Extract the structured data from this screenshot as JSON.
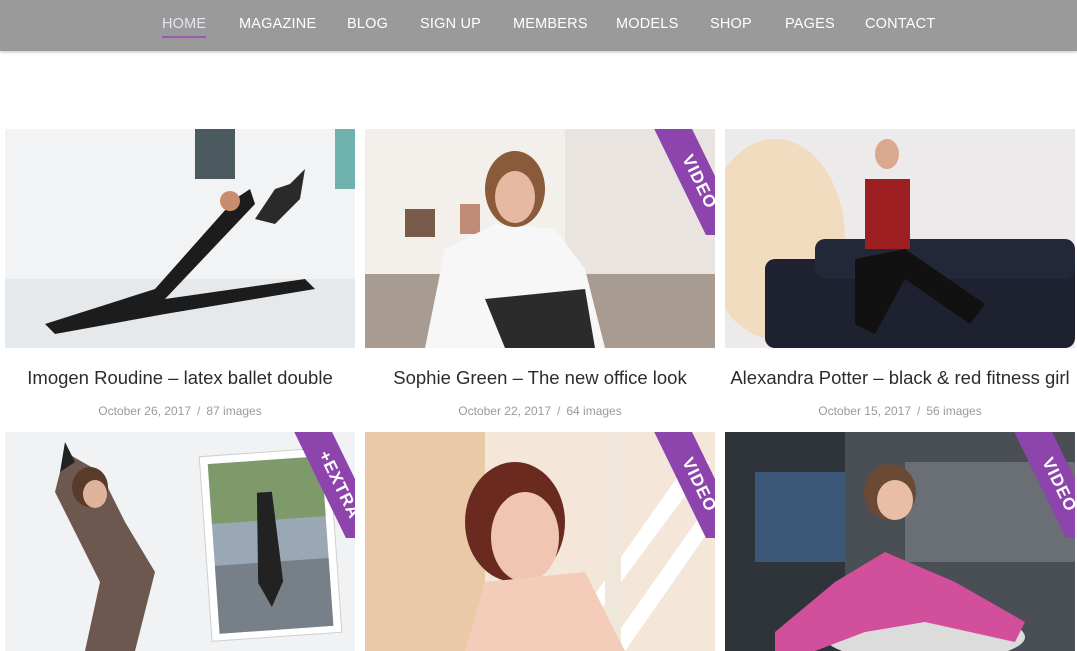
{
  "nav": {
    "items": [
      {
        "label": "HOME",
        "active": true
      },
      {
        "label": "MAGAZINE"
      },
      {
        "label": "BLOG"
      },
      {
        "label": "SIGN UP"
      },
      {
        "label": "MEMBERS"
      },
      {
        "label": "MODELS"
      },
      {
        "label": "SHOP"
      },
      {
        "label": "PAGES"
      },
      {
        "label": "CONTACT"
      }
    ],
    "colors": {
      "bar": "#9a9a9a",
      "active_underline": "#9b59b6"
    }
  },
  "ribbon_color": "#8e44ad",
  "gallery": [
    {
      "title": "Imogen Roudine – latex ballet double",
      "date": "October 26, 2017",
      "count": "87 images",
      "ribbon": ""
    },
    {
      "title": "Sophie Green – The new office look",
      "date": "October 22, 2017",
      "count": "64 images",
      "ribbon": "VIDEO"
    },
    {
      "title": "Alexandra Potter – black & red fitness girl",
      "date": "October 15, 2017",
      "count": "56 images",
      "ribbon": ""
    },
    {
      "title": "",
      "date": "",
      "count": "",
      "ribbon": "+EXTRA"
    },
    {
      "title": "",
      "date": "",
      "count": "",
      "ribbon": "VIDEO"
    },
    {
      "title": "",
      "date": "",
      "count": "",
      "ribbon": "VIDEO"
    }
  ]
}
